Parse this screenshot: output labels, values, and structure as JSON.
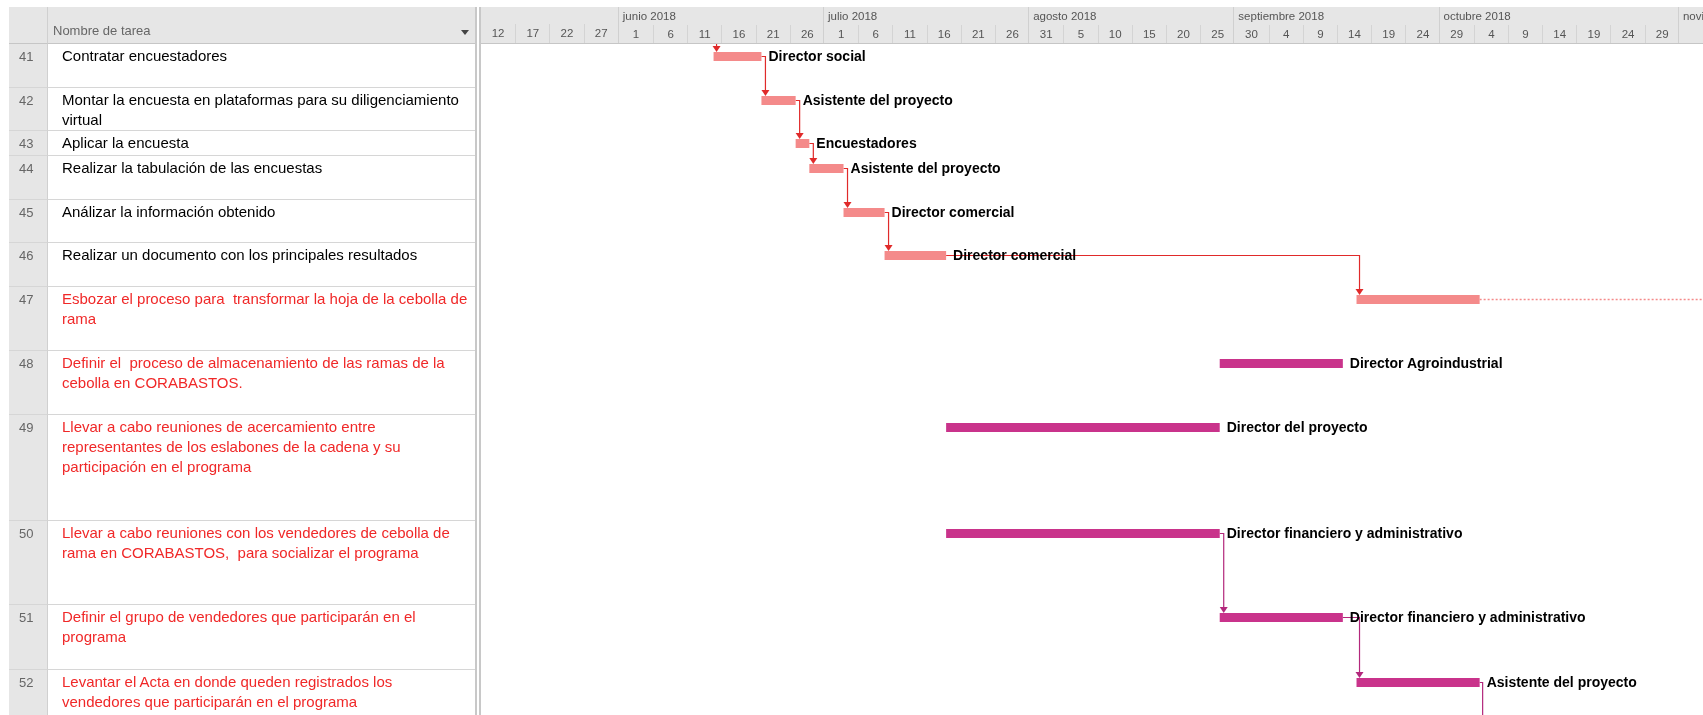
{
  "columns": {
    "name": "Nombre de tarea"
  },
  "timescale": {
    "months": [
      {
        "ticks": [
          "12",
          "17",
          "22",
          "27"
        ]
      },
      {
        "label": "junio 2018",
        "ticks": [
          "1",
          "6",
          "11",
          "16",
          "21",
          "26"
        ]
      },
      {
        "label": "julio 2018",
        "ticks": [
          "1",
          "6",
          "11",
          "16",
          "21",
          "26"
        ]
      },
      {
        "label": "agosto 2018",
        "ticks": [
          "31",
          "5",
          "10",
          "15",
          "20",
          "25"
        ]
      },
      {
        "label": "septiembre 2018",
        "ticks": [
          "30",
          "4",
          "9",
          "14",
          "19",
          "24"
        ]
      },
      {
        "label": "octubre 2018",
        "ticks": [
          "29",
          "4",
          "9",
          "14",
          "19",
          "24",
          "29"
        ]
      },
      {
        "label": "novi"
      }
    ]
  },
  "tasks": [
    {
      "id": "41",
      "name": "Contratar encuestadores",
      "color": "#000000",
      "linked_from_previous": true,
      "slack": false,
      "bar": {
        "color": "#f48a8a",
        "resource": "Director social"
      }
    },
    {
      "id": "42",
      "name": "Montar la encuesta en plataformas para su diligenciamiento virtual",
      "color": "#000000",
      "linked_from_previous": true,
      "slack": false,
      "bar": {
        "color": "#f48a8a",
        "resource": "Asistente del proyecto"
      }
    },
    {
      "id": "43",
      "name": "Aplicar la encuesta",
      "color": "#000000",
      "linked_from_previous": true,
      "slack": false,
      "bar": {
        "color": "#f48a8a",
        "resource": "Encuestadores"
      }
    },
    {
      "id": "44",
      "name": "Realizar la tabulación de las encuestas",
      "color": "#000000",
      "linked_from_previous": true,
      "slack": false,
      "bar": {
        "color": "#f48a8a",
        "resource": "Asistente del proyecto"
      }
    },
    {
      "id": "45",
      "name": "Análizar la información obtenido",
      "color": "#000000",
      "linked_from_previous": true,
      "slack": false,
      "bar": {
        "color": "#f48a8a",
        "resource": "Director comercial"
      }
    },
    {
      "id": "46",
      "name": "Realizar un documento con los principales resultados",
      "color": "#000000",
      "linked_from_previous": true,
      "slack": false,
      "bar": {
        "color": "#f48a8a",
        "resource": "Director comercial"
      }
    },
    {
      "id": "47",
      "name": "Esbozar el proceso para  transformar la hoja de la cebolla de rama",
      "color": "#f02828",
      "linked_from_previous": true,
      "slack": true,
      "bar": {
        "color": "#f48a8a"
      }
    },
    {
      "id": "48",
      "name": "Definir el  proceso de almacenamiento de las ramas de la cebolla en CORABASTOS.",
      "color": "#f02828",
      "linked_from_previous": false,
      "slack": false,
      "bar": {
        "color": "#c9338b",
        "resource": "Director Agroindustrial"
      }
    },
    {
      "id": "49",
      "name": "Llevar a cabo reuniones de acercamiento entre representantes de los eslabones de la cadena y su participación en el programa",
      "color": "#f02828",
      "linked_from_previous": false,
      "slack": false,
      "bar": {
        "color": "#c9338b",
        "resource": "Director del proyecto"
      }
    },
    {
      "id": "50",
      "name": "Llevar a cabo reuniones con los vendedores de cebolla de rama en CORABASTOS,  para socializar el programa",
      "color": "#f02828",
      "linked_from_previous": false,
      "slack": false,
      "bar": {
        "color": "#c9338b",
        "resource": "Director financiero y administrativo"
      }
    },
    {
      "id": "51",
      "name": "Definir el grupo de vendedores que participarán en el programa",
      "color": "#f02828",
      "linked_from_previous": true,
      "slack": false,
      "bar": {
        "color": "#c9338b",
        "resource": "Director financiero y administrativo"
      }
    },
    {
      "id": "52",
      "name": "Levantar el Acta en donde queden registrados los vendedores que participarán en el programa",
      "color": "#f02828",
      "linked_from_previous": true,
      "slack": false,
      "bar": {
        "color": "#c9338b",
        "resource": "Asistente del proyecto"
      }
    }
  ],
  "link_below": true
}
